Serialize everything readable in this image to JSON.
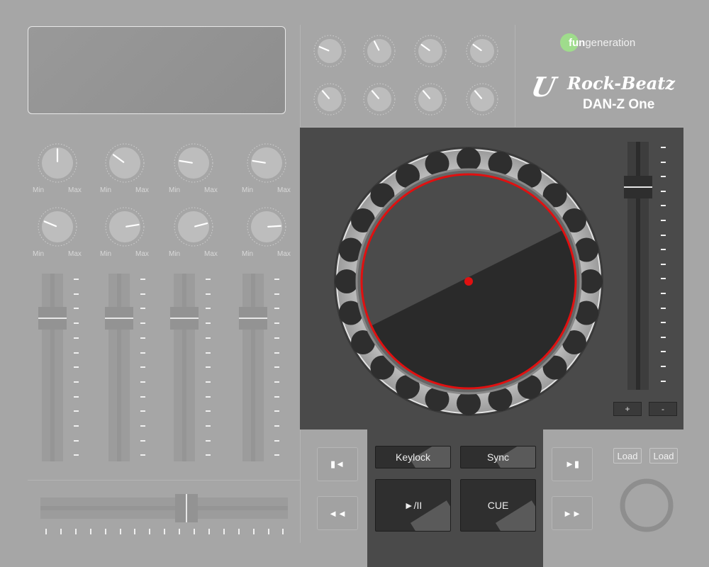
{
  "brand": {
    "prefix": "fun",
    "suffix": "generation"
  },
  "logo": {
    "u": "U",
    "name": "Rock-Beatz",
    "model": "DAN-Z One"
  },
  "knob_labels": {
    "min": "Min",
    "max": "Max"
  },
  "mixer": {
    "knob_rows": [
      [
        {
          "value": 0.5
        },
        {
          "value": 0.3
        },
        {
          "value": 0.2
        },
        {
          "value": 0.2
        }
      ],
      [
        {
          "value": 0.25
        },
        {
          "value": 0.8
        },
        {
          "value": 0.78
        },
        {
          "value": 0.82
        }
      ]
    ],
    "channel_faders": [
      0.8,
      0.8,
      0.8,
      0.8
    ],
    "crossfader": 0.6
  },
  "fx_knobs": [
    0.25,
    0.4,
    0.3,
    0.3,
    0.35,
    0.35,
    0.35,
    0.35
  ],
  "deck": {
    "pitch_fader": 0.85,
    "pitch_plus": "+",
    "pitch_minus": "-",
    "keylock": "Keylock",
    "sync": "Sync",
    "play_pause": "►/II",
    "cue": "CUE"
  },
  "transport": {
    "prev": "▮◄",
    "rewind": "◄◄",
    "next": "►▮",
    "forward": "►►"
  },
  "load": {
    "left": "Load",
    "right": "Load"
  },
  "colors": {
    "accent": "#e01010",
    "brand_green": "#9fdc8c"
  }
}
